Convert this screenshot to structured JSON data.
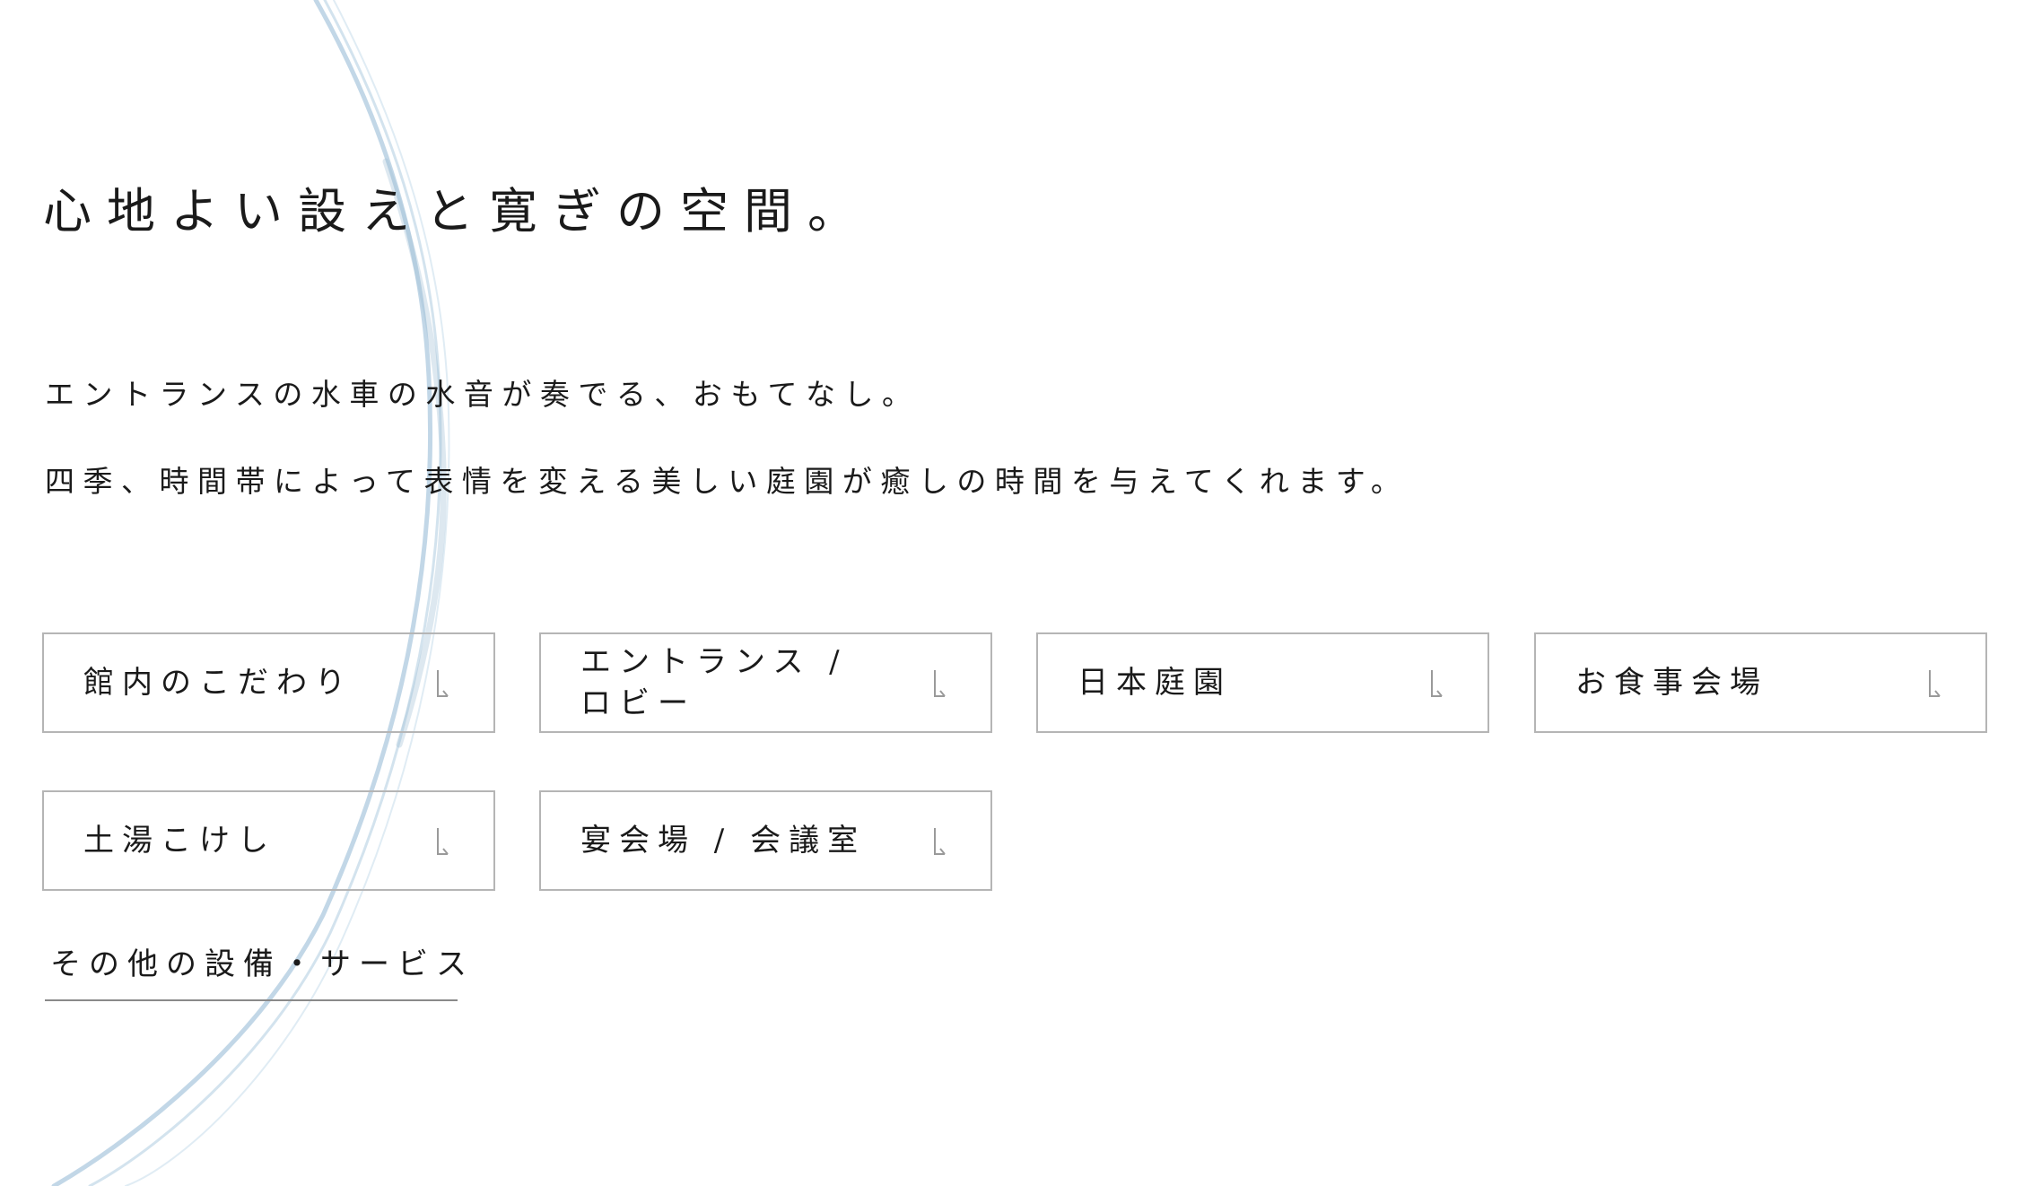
{
  "section": {
    "heading": "心地よい設えと寛ぎの空間。",
    "paragraphs": [
      "エントランスの水車の水音が奏でる、おもてなし。",
      "四季、時間帯によって表情を変える美しい庭園が癒しの時間を与えてくれます。"
    ]
  },
  "buttons": [
    {
      "label": "館内のこだわり",
      "icon": "arrow-down-icon"
    },
    {
      "label": "エントランス / ロビー",
      "icon": "arrow-down-icon"
    },
    {
      "label": "日本庭園",
      "icon": "arrow-down-icon"
    },
    {
      "label": "お食事会場",
      "icon": "arrow-down-icon"
    },
    {
      "label": "土湯こけし",
      "icon": "arrow-down-icon"
    },
    {
      "label": "宴会場 / 会議室",
      "icon": "arrow-down-icon"
    }
  ],
  "text_link": {
    "label": "その他の設備・サービス"
  },
  "colors": {
    "text": "#1a1a1a",
    "button_border": "#b5b5b5",
    "arrow": "#9a9a9a",
    "brush_stroke": "#a9c6dd"
  }
}
